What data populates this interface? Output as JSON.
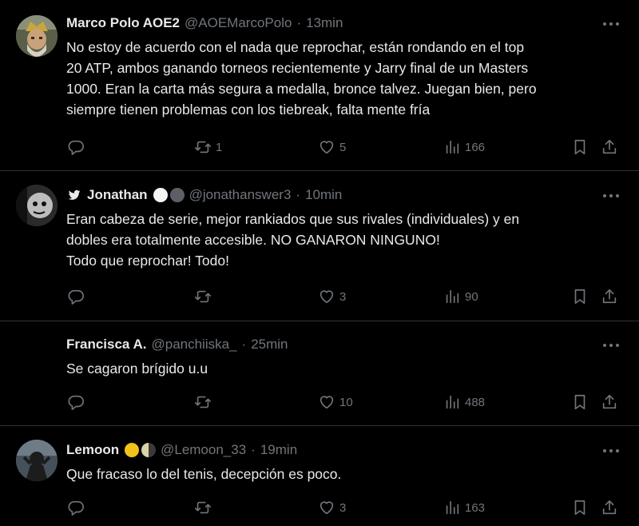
{
  "colors": {
    "background": "#000000",
    "text": "#e7e9ea",
    "muted": "#71767b",
    "divider": "#2f3336"
  },
  "tweets": [
    {
      "name": "Marco Polo AOE2",
      "handle": "@AOEMarcoPolo",
      "sep": "·",
      "time": "13min",
      "text_lines": [
        "No estoy de acuerdo con el nada que reprochar, están rondando en el top",
        "20 ATP, ambos ganando torneos recientemente y Jarry final de un Masters",
        "1000. Eran la carta más segura a medalla, bronce talvez. Juegan bien, pero",
        "siempre tienen problemas con los tiebreak, falta mente fría"
      ],
      "reposts": "1",
      "likes": "5",
      "views": "166"
    },
    {
      "name": "Jonathan",
      "handle": "@jonathanswer3",
      "sep": "·",
      "time": "10min",
      "text_lines": [
        "Eran cabeza de serie, mejor rankiados que sus rivales (individuales) y en",
        "dobles era totalmente accesible. NO GANARON NINGUNO!",
        "Todo que reprochar! Todo!"
      ],
      "reposts": "",
      "likes": "3",
      "views": "90"
    },
    {
      "name": "Francisca A.",
      "handle": "@panchiiska_",
      "sep": "·",
      "time": "25min",
      "text_lines": [
        "Se cagaron brígido u.u"
      ],
      "reposts": "",
      "likes": "10",
      "views": "488"
    },
    {
      "name": "Lemoon",
      "handle": "@Lemoon_33",
      "sep": "·",
      "time": "19min",
      "text_lines": [
        "Que fracaso lo del tenis, decepción es poco."
      ],
      "reposts": "",
      "likes": "3",
      "views": "163"
    }
  ],
  "icons": {
    "reply": "reply-icon",
    "repost": "repost-icon",
    "like": "heart-icon",
    "views": "views-icon",
    "bookmark": "bookmark-icon",
    "share": "share-icon",
    "more": "more-icon",
    "bird": "bird-icon"
  }
}
